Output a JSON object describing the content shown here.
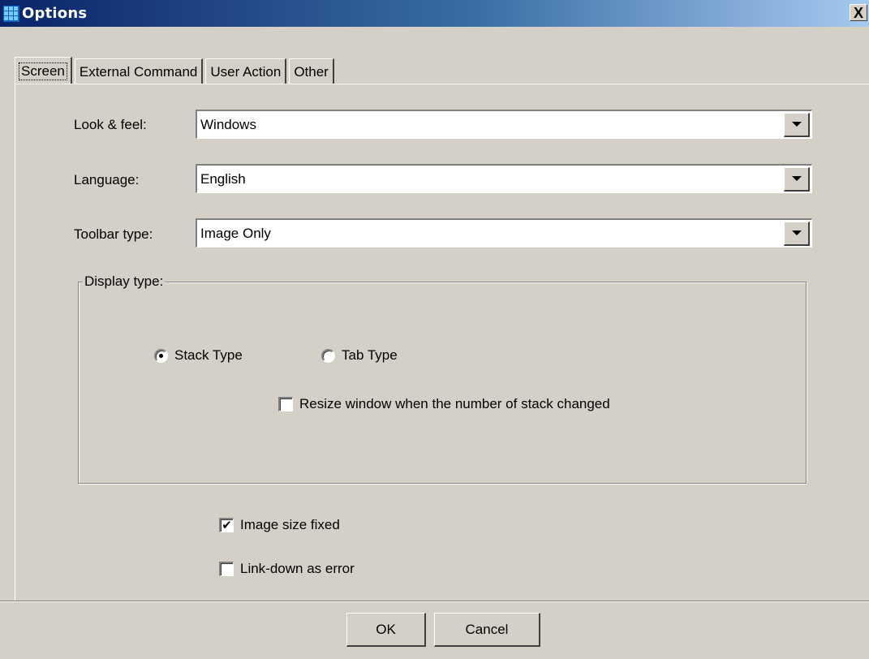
{
  "window": {
    "title": "Options",
    "close_glyph": "X"
  },
  "tabs": [
    {
      "label": "Screen",
      "active": true
    },
    {
      "label": "External Command",
      "active": false
    },
    {
      "label": "User Action",
      "active": false
    },
    {
      "label": "Other",
      "active": false
    }
  ],
  "fields": {
    "look_feel": {
      "label": "Look & feel:",
      "value": "Windows"
    },
    "language": {
      "label": "Language:",
      "value": "English"
    },
    "toolbar_type": {
      "label": "Toolbar type:",
      "value": "Image Only"
    }
  },
  "display_type": {
    "label": "Display type:",
    "stack_type": {
      "label": "Stack Type",
      "selected": true
    },
    "tab_type": {
      "label": "Tab Type",
      "selected": false
    },
    "resize_window": {
      "label": "Resize window when the number of stack changed",
      "checked": false
    }
  },
  "options": {
    "image_size_fixed": {
      "label": "Image size fixed",
      "checked": true
    },
    "link_down_error": {
      "label": "Link-down as error",
      "checked": false
    }
  },
  "buttons": {
    "ok": "OK",
    "cancel": "Cancel"
  },
  "icons": {
    "app": "grid-icon",
    "close": "close-icon",
    "dropdown": "chevron-down-icon",
    "check": "✔"
  }
}
